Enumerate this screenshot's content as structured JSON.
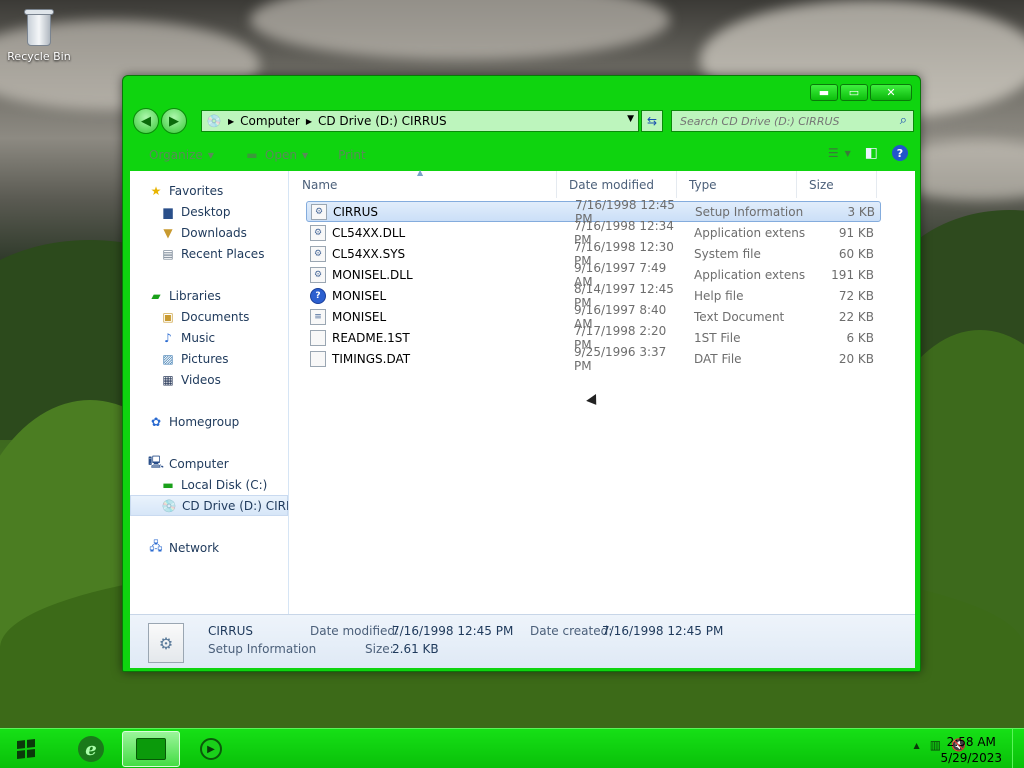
{
  "desktop": {
    "recycle_bin_label": "Recycle Bin"
  },
  "window": {
    "controls": {
      "minimize": "▬",
      "maximize": "▭",
      "close": "✕"
    },
    "address": {
      "root": "Computer",
      "location": "CD Drive (D:) CIRRUS"
    },
    "search": {
      "placeholder": "Search CD Drive (D:) CIRRUS"
    },
    "toolbar": {
      "organize": "Organize",
      "open": "Open",
      "print": "Print"
    }
  },
  "navpane": {
    "favorites": "Favorites",
    "desktop": "Desktop",
    "downloads": "Downloads",
    "recent_places": "Recent Places",
    "libraries": "Libraries",
    "documents": "Documents",
    "music": "Music",
    "pictures": "Pictures",
    "videos": "Videos",
    "homegroup": "Homegroup",
    "computer": "Computer",
    "local_disk": "Local Disk (C:)",
    "cd_drive": "CD Drive (D:) CIRRUS",
    "network": "Network"
  },
  "columns": {
    "name": "Name",
    "date": "Date modified",
    "type": "Type",
    "size": "Size"
  },
  "files": [
    {
      "name": "CIRRUS",
      "date": "7/16/1998 12:45 PM",
      "type": "Setup Information",
      "size": "3 KB",
      "icon": "setup-icon"
    },
    {
      "name": "CL54XX.DLL",
      "date": "7/16/1998 12:34 PM",
      "type": "Application extens...",
      "size": "91 KB",
      "icon": "dll-icon"
    },
    {
      "name": "CL54XX.SYS",
      "date": "7/16/1998 12:30 PM",
      "type": "System file",
      "size": "60 KB",
      "icon": "sys-icon"
    },
    {
      "name": "MONISEL.DLL",
      "date": "9/16/1997 7:49 AM",
      "type": "Application extens...",
      "size": "191 KB",
      "icon": "dll-icon"
    },
    {
      "name": "MONISEL",
      "date": "8/14/1997 12:45 PM",
      "type": "Help file",
      "size": "72 KB",
      "icon": "help-icon"
    },
    {
      "name": "MONISEL",
      "date": "9/16/1997 8:40 AM",
      "type": "Text Document",
      "size": "22 KB",
      "icon": "text-icon"
    },
    {
      "name": "README.1ST",
      "date": "7/17/1998 2:20 PM",
      "type": "1ST File",
      "size": "6 KB",
      "icon": "file-icon"
    },
    {
      "name": "TIMINGS.DAT",
      "date": "9/25/1996 3:37 PM",
      "type": "DAT File",
      "size": "20 KB",
      "icon": "file-icon"
    }
  ],
  "details": {
    "name": "CIRRUS",
    "type": "Setup Information",
    "date_modified_label": "Date modified:",
    "date_modified": "7/16/1998 12:45 PM",
    "size_label": "Size:",
    "size": "2.61 KB",
    "date_created_label": "Date created:",
    "date_created": "7/16/1998 12:45 PM"
  },
  "taskbar": {
    "time": "2:58 AM",
    "date": "5/29/2023"
  },
  "colors": {
    "window_frame": "#0fd40f",
    "taskbar": "#16e016",
    "selection": "#cbdff7"
  }
}
